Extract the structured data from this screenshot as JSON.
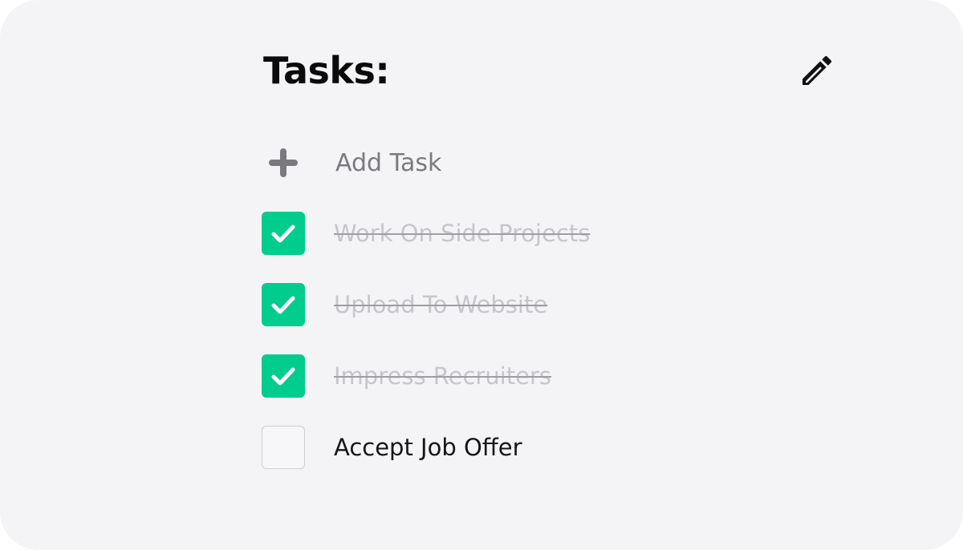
{
  "header": {
    "title": "Tasks:",
    "edit_icon": "pencil-icon"
  },
  "add_task": {
    "icon": "plus-icon",
    "label": "Add Task"
  },
  "colors": {
    "background": "#f4f4f7",
    "accent": "#00cc8e",
    "done_text": "#c7c7cb",
    "open_text": "#161616"
  },
  "tasks": [
    {
      "label": "Work On Side Projects",
      "done": true
    },
    {
      "label": "Upload To Website",
      "done": true
    },
    {
      "label": "Impress Recruiters",
      "done": true
    },
    {
      "label": "Accept Job Offer",
      "done": false
    }
  ]
}
